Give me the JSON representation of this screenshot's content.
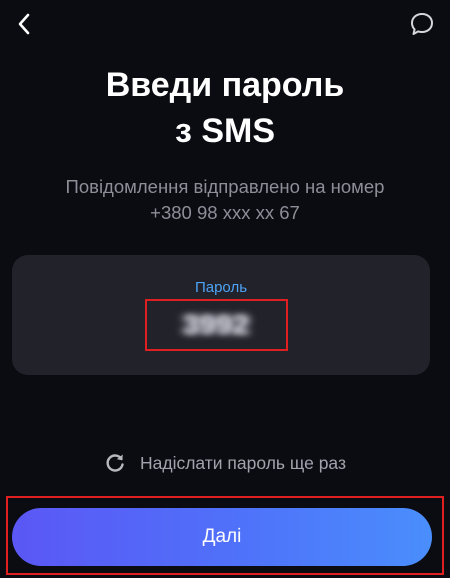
{
  "header": {
    "back_icon": "chevron-left-icon",
    "chat_icon": "chat-bubble-icon"
  },
  "title": {
    "line1": "Введи пароль",
    "line2": "з SMS"
  },
  "subtitle": {
    "line1": "Повідомлення відправлено на номер",
    "line2": "+380 98 xxx xx 67"
  },
  "password": {
    "label": "Пароль",
    "value": "3992"
  },
  "resend": {
    "icon": "refresh-icon",
    "label": "Надіслати пароль ще раз"
  },
  "next_button": {
    "label": "Далі"
  },
  "colors": {
    "background": "#0b0b12",
    "card": "#22222a",
    "accent_label": "#4da3f5",
    "highlight_border": "#e02020",
    "button_gradient_start": "#5b57f5",
    "button_gradient_end": "#4a8efc"
  }
}
